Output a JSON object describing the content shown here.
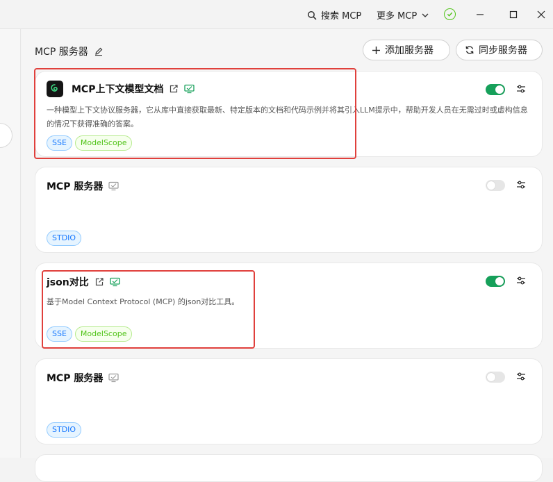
{
  "topbar": {
    "search_label": "搜索 MCP",
    "more_label": "更多 MCP"
  },
  "main": {
    "heading": "MCP 服务器",
    "add_button": "添加服务器",
    "sync_button": "同步服务器"
  },
  "cards": [
    {
      "title": "MCP上下文模型文档",
      "description": "一种模型上下文协议服务器，它从库中直接获取最新、特定版本的文档和代码示例并将其引入LLM提示中，帮助开发人员在无需过时或虚构信息的情况下获得准确的答案。",
      "tags": [
        "SSE",
        "ModelScope"
      ],
      "enabled": true
    },
    {
      "title": "MCP 服务器",
      "description": "",
      "tags": [
        "STDIO"
      ],
      "enabled": false
    },
    {
      "title": "json对比",
      "description": "基于Model Context Protocol (MCP) 的json对比工具。",
      "tags": [
        "SSE",
        "ModelScope"
      ],
      "enabled": true
    },
    {
      "title": "MCP 服务器",
      "description": "",
      "tags": [
        "STDIO"
      ],
      "enabled": false
    }
  ],
  "colors": {
    "accent_green": "#16a05a",
    "highlight_red": "#e0403c",
    "tag_blue": "#1677ff",
    "tag_green": "#52c41a"
  },
  "icons": [
    "search-icon",
    "chevron-down-icon",
    "check-circle-icon",
    "minimize-icon",
    "maximize-icon",
    "close-icon",
    "edit-icon",
    "plus-icon",
    "sync-icon",
    "external-link-icon",
    "monitor-icon",
    "settings-sliders-icon"
  ]
}
